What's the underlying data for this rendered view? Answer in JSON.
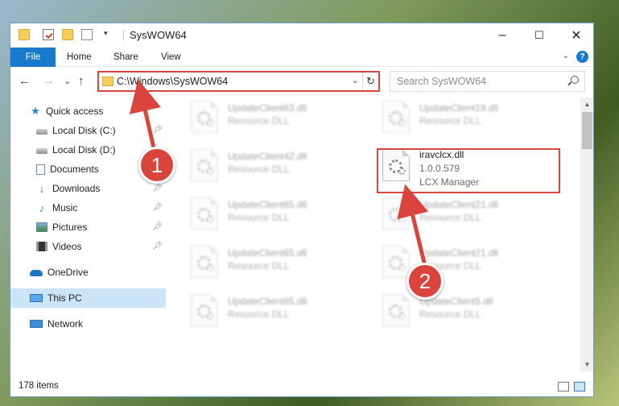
{
  "window": {
    "title": "SysWOW64",
    "minimize": "–",
    "maximize": "☐",
    "close": "✕"
  },
  "ribbon": {
    "tabs": [
      "File",
      "Home",
      "Share",
      "View"
    ],
    "help": "?",
    "collapse": "⌄"
  },
  "nav": {
    "back": "←",
    "forward": "→",
    "recent": "⌄",
    "up": "↑",
    "address": "C:\\Windows\\SysWOW64",
    "refresh": "↻",
    "search_placeholder": "Search SysWOW64"
  },
  "sidebar": {
    "items": [
      {
        "label": "Quick access",
        "icon": "star-icon",
        "pinned": false
      },
      {
        "label": "Local Disk (C:)",
        "icon": "disk-icon",
        "pinned": true
      },
      {
        "label": "Local Disk (D:)",
        "icon": "disk-icon",
        "pinned": false
      },
      {
        "label": "Documents",
        "icon": "documents-icon",
        "pinned": true
      },
      {
        "label": "Downloads",
        "icon": "download-icon",
        "pinned": true
      },
      {
        "label": "Music",
        "icon": "music-icon",
        "pinned": true
      },
      {
        "label": "Pictures",
        "icon": "pictures-icon",
        "pinned": true
      },
      {
        "label": "Videos",
        "icon": "videos-icon",
        "pinned": true
      },
      {
        "label": "OneDrive",
        "icon": "onedrive-icon",
        "pinned": false
      },
      {
        "label": "This PC",
        "icon": "pc-icon",
        "pinned": false,
        "selected": true
      },
      {
        "label": "Network",
        "icon": "network-icon",
        "pinned": false
      }
    ]
  },
  "files": {
    "left": [
      {
        "name": "UpdateClient63.dll",
        "type": "Resource DLL"
      },
      {
        "name": "UpdateClient42.dll",
        "type": "Resource DLL"
      },
      {
        "name": "UpdateClient65.dll",
        "type": "Resource DLL"
      },
      {
        "name": "UpdateClient65.dll",
        "type": "Resource DLL"
      },
      {
        "name": "UpdateClient65.dll",
        "type": "Resource DLL"
      }
    ],
    "right": [
      {
        "name": "UpdateClient19.dll",
        "type": "Resource DLL"
      },
      {
        "name": "UpdateClient21.dll",
        "type": "Resource DLL"
      },
      {
        "name": "UpdateClient21.dll",
        "type": "Resource DLL"
      },
      {
        "name": "UpdateClient5.dll",
        "type": "Resource DLL"
      }
    ],
    "highlighted": {
      "name": "iravclcx.dll",
      "version": "1.0.0.579",
      "description": "LCX Manager"
    }
  },
  "status": {
    "item_count": "178 items"
  },
  "callouts": [
    "1",
    "2"
  ],
  "colors": {
    "accent": "#1979ca",
    "highlight": "#d9443c",
    "selected": "#cce4f7"
  }
}
